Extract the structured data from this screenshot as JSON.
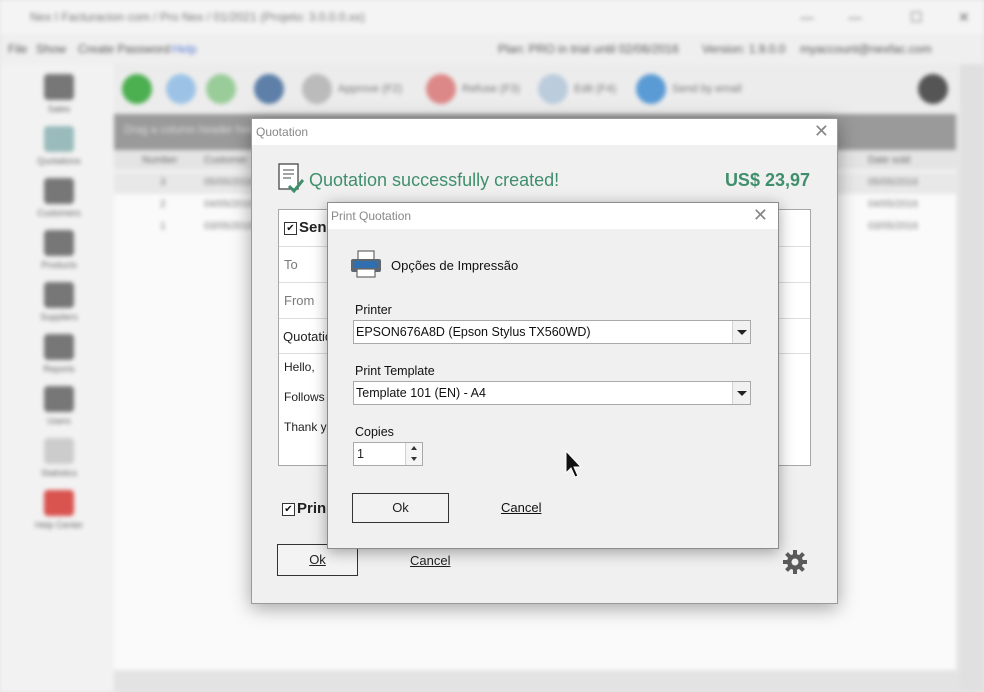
{
  "background_app": {
    "window_title": "Nex I Facturacion com / Pro Nex / 01/2021 (Projeto: 3.0.0.0.xx)",
    "menu": [
      "File",
      "Show",
      "Create Password",
      "Help"
    ],
    "status_plan": "Plan: PRO in trial until 02/06/2016",
    "version": "Version: 1.9.0.0",
    "account": "myaccount@nexfac.com",
    "sidebar": [
      "Sales",
      "Quotations",
      "Customers",
      "Products",
      "Suppliers",
      "Reports",
      "Users",
      "Statistics",
      "Help Center"
    ],
    "toolbar": [
      "Approve (F2)",
      "Refuse (F3)",
      "Edit (F4)",
      "Send by email"
    ],
    "filter_placeholder": "Drag a column header here to group",
    "grid_headers": [
      "Number",
      "Customer",
      "Date sold"
    ],
    "grid_rows": [
      {
        "number": "3",
        "customer": "05/05/2016",
        "date": "05/05/2016"
      },
      {
        "number": "2",
        "customer": "04/05/2016",
        "date": "04/05/2016"
      },
      {
        "number": "1",
        "customer": "03/05/2016",
        "date": "03/05/2016"
      }
    ]
  },
  "quotation": {
    "title": "Quotation",
    "success_message": "Quotation successfully created!",
    "total": "US$ 23,97",
    "send_label": "Sen",
    "to_label": "To",
    "from_label": "From",
    "subject": "Quotatio",
    "body": [
      "Hello,",
      "Follows",
      "Thank yo"
    ],
    "print_label": "Prin",
    "ok_label": "Ok",
    "cancel_label": "Cancel",
    "close_glyph": "✕"
  },
  "print_dialog": {
    "title": "Print Quotation",
    "heading": "Opções de Impressão",
    "printer_label": "Printer",
    "printer_value": "EPSON676A8D (Epson Stylus TX560WD)",
    "template_label": "Print Template",
    "template_value": "Template 101 (EN) - A4",
    "copies_label": "Copies",
    "copies_value": "1",
    "ok_label": "Ok",
    "cancel_label": "Cancel",
    "close_glyph": "✕"
  },
  "colors": {
    "success_green": "#3f8f6c",
    "printer_blue": "#2f6fb0"
  }
}
